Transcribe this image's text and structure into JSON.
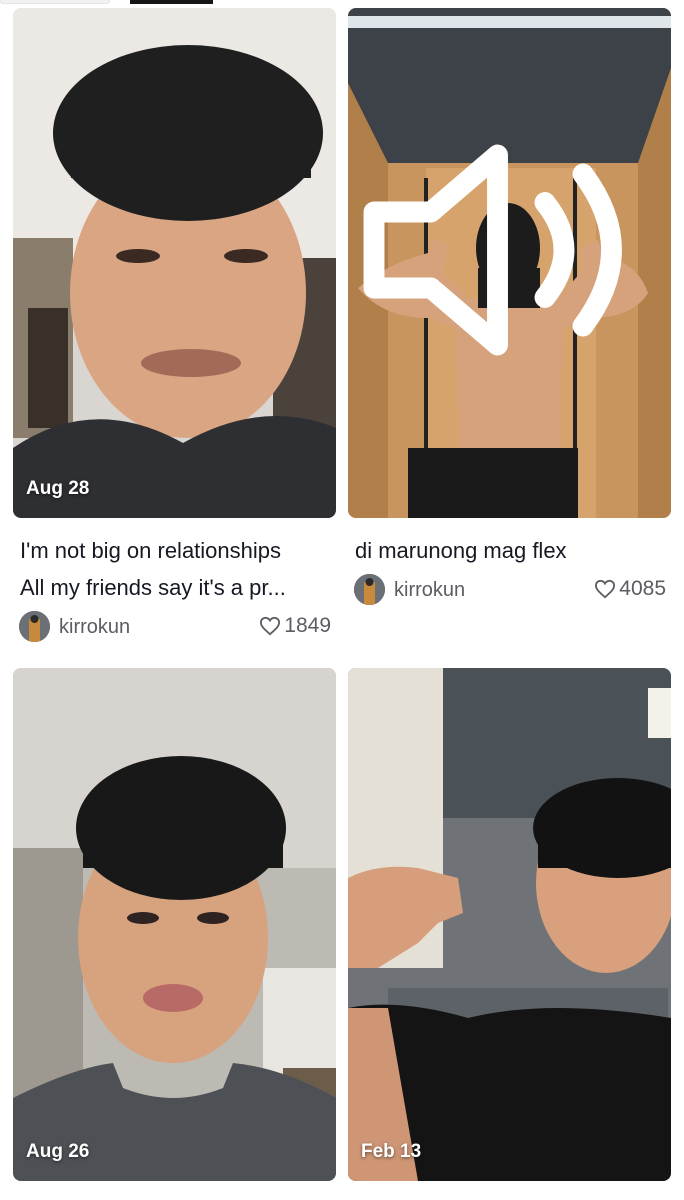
{
  "videos": [
    {
      "date": "Aug 28",
      "caption_line1": "I'm not big on relationships",
      "caption_line2": "All my friends say it's a pr...",
      "username": "kirrokun",
      "likes": "1849"
    },
    {
      "date": "",
      "caption_line1": "di marunong mag flex",
      "username": "kirrokun",
      "likes": "4085",
      "sound_icon": "speaker-icon"
    },
    {
      "date": "Aug 26"
    },
    {
      "date": "Feb 13"
    }
  ],
  "icons": {
    "like": "heart-outline-icon",
    "sound": "speaker-icon"
  },
  "colors": {
    "text_primary": "#161823",
    "text_secondary": "#5c5c63",
    "badge_text": "#ffffff",
    "background": "#ffffff"
  }
}
